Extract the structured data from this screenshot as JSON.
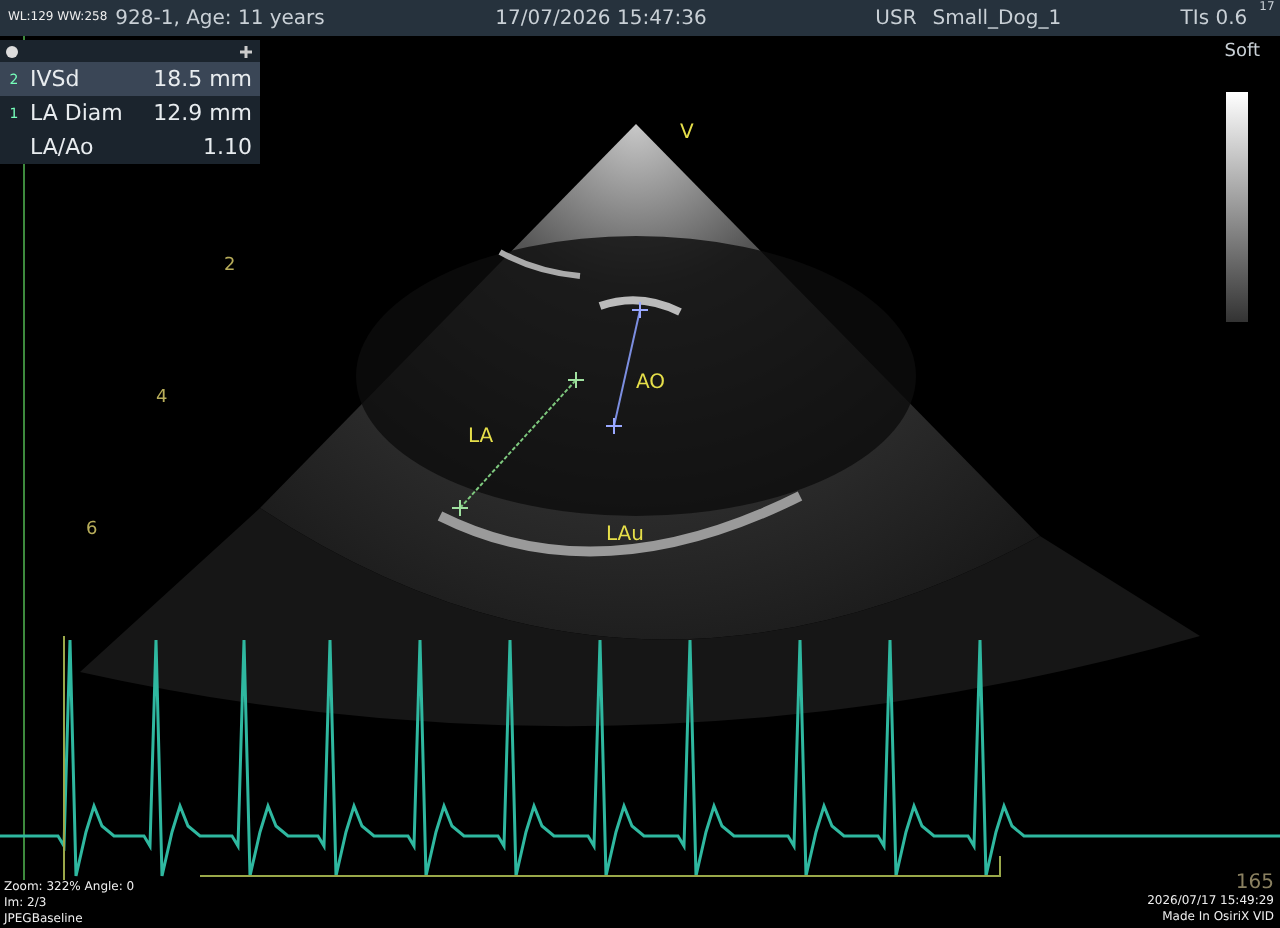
{
  "header": {
    "window_level": "WL:129 WW:258",
    "patient": "928-1, Age: 11 years",
    "datetime": "17/07/2026 15:47:36",
    "user_label": "USR",
    "preset": "Small_Dog_1",
    "tis": "TIs 0.6",
    "frame_rate": "17"
  },
  "measurements": {
    "rows": [
      {
        "index": "2",
        "name": "IVSd",
        "value": "18.5 mm",
        "selected": true
      },
      {
        "index": "1",
        "name": "LA Diam",
        "value": "12.9 mm",
        "selected": false
      },
      {
        "index": "",
        "name": "LA/Ao",
        "value": "1.10",
        "selected": false
      }
    ]
  },
  "image": {
    "probe_mark": "V",
    "depth_marks": [
      "2",
      "4",
      "6"
    ],
    "structure_labels": [
      "LA",
      "AO",
      "LAu"
    ],
    "map_label": "Soft"
  },
  "footer": {
    "left": [
      "Zoom: 322% Angle: 0",
      "Im: 2/3",
      "JPEGBaseline"
    ],
    "heart_rate": "165",
    "acquired": "2026/07/17 15:49:29",
    "source": "Made In OsiriX VID"
  }
}
